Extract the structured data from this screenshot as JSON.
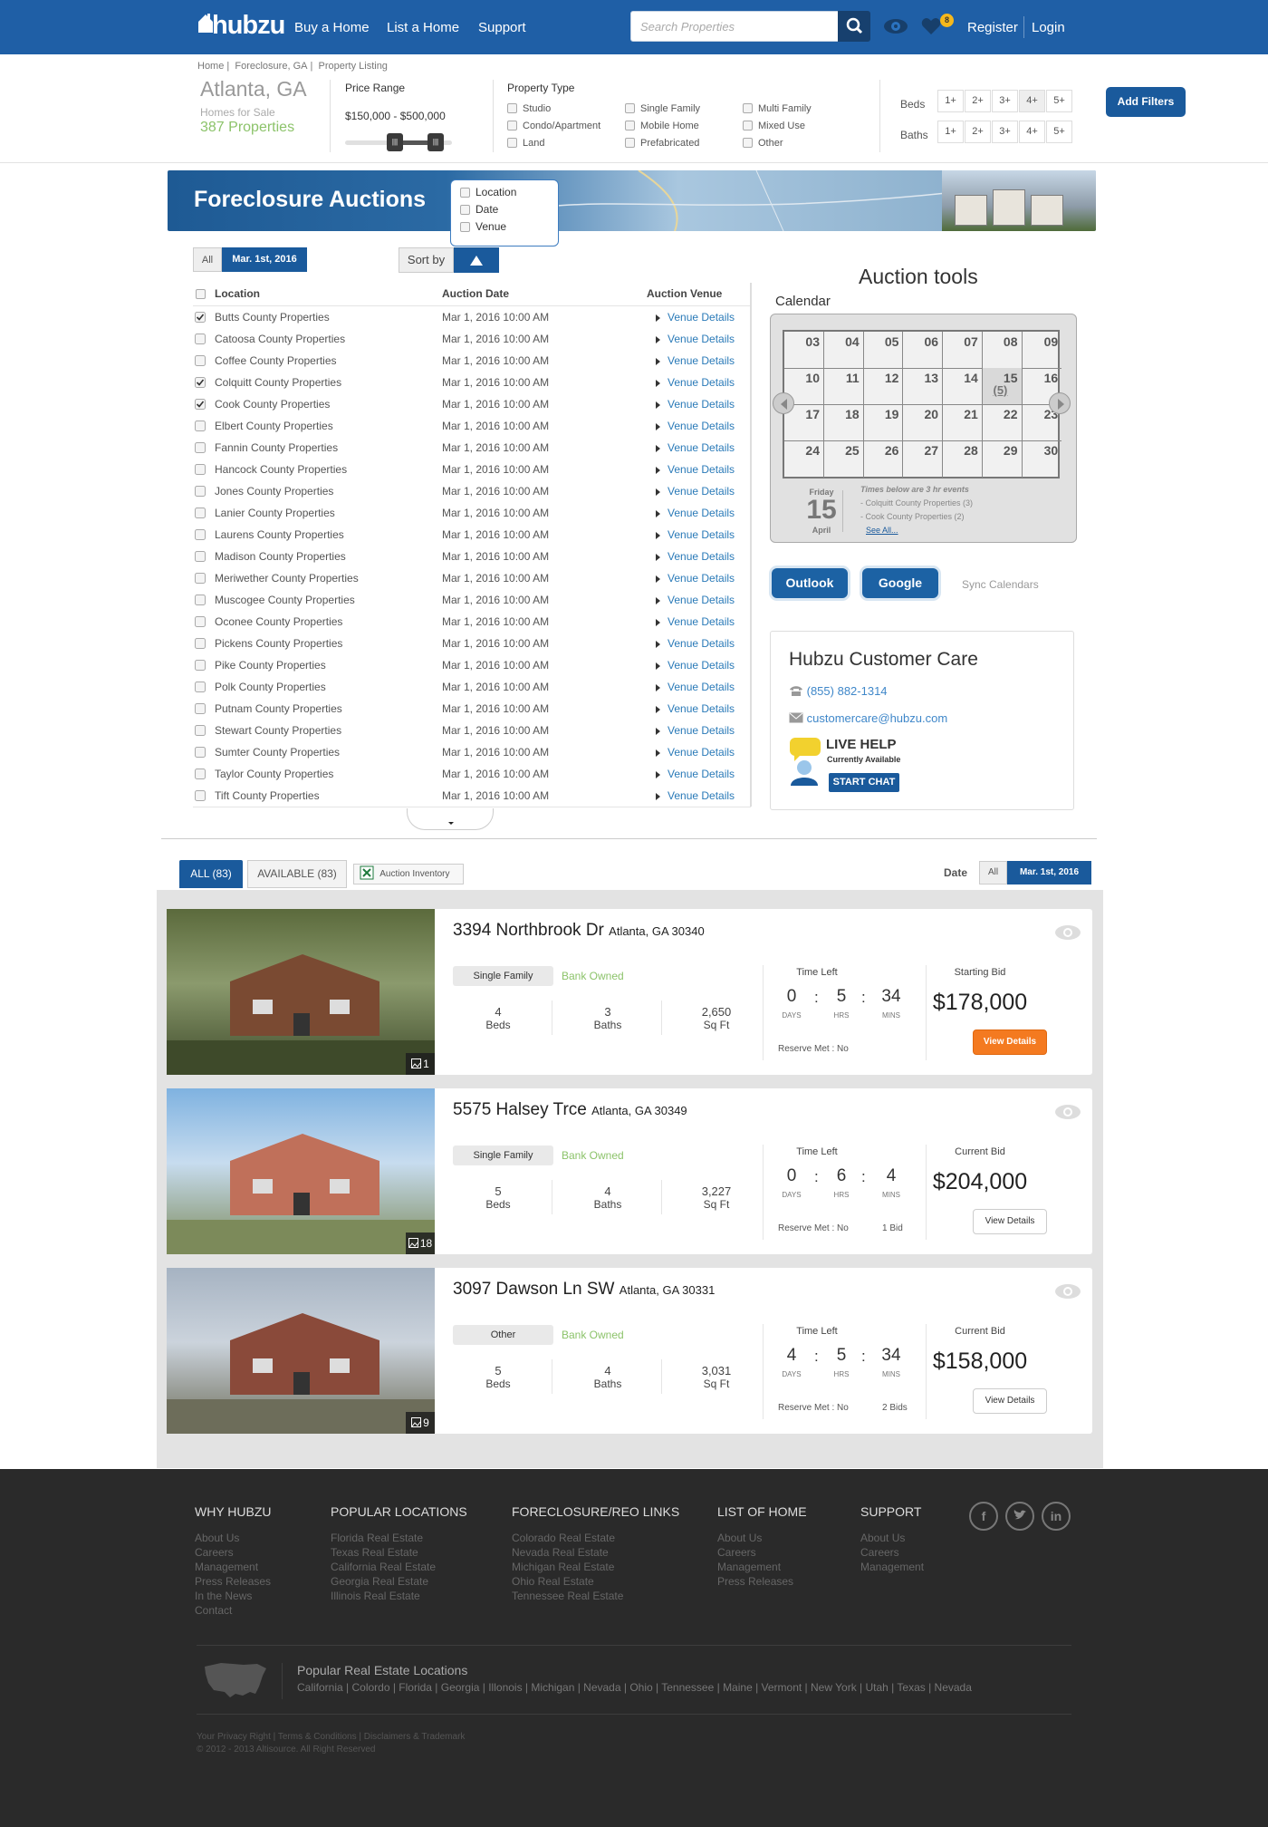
{
  "header": {
    "logo": "hubzu",
    "nav": [
      "Buy a Home",
      "List a Home",
      "Support"
    ],
    "search_placeholder": "Search Properties",
    "favorites_count": "8",
    "register": "Register",
    "login": "Login"
  },
  "filters": {
    "breadcrumb": [
      "Home",
      "Foreclosure, GA",
      "Property Listing"
    ],
    "city": "Atlanta, GA",
    "homes_for_sale": "Homes for Sale",
    "properties": "387 Properties",
    "price_range_label": "Price Range",
    "price_range_value": "$150,000 - $500,000",
    "property_type_label": "Property Type",
    "property_types": [
      "Studio",
      "Condo/Apartment",
      "Land",
      "Single Family",
      "Mobile Home",
      "Prefabricated",
      "Multi Family",
      "Mixed Use",
      "Other"
    ],
    "beds_label": "Beds",
    "baths_label": "Baths",
    "bed_options": [
      "1+",
      "2+",
      "3+",
      "4+",
      "5+"
    ],
    "bath_options": [
      "1+",
      "2+",
      "3+",
      "4+",
      "5+"
    ],
    "add_filters": "Add Filters"
  },
  "auctions": {
    "banner_title": "Foreclosure Auctions",
    "sort_options": [
      "Location",
      "Date",
      "Venue"
    ],
    "seg_all": "All",
    "seg_date": "Mar. 1st, 2016",
    "sort_by": "Sort by",
    "col_location": "Location",
    "col_date": "Auction Date",
    "col_venue": "Auction Venue",
    "rows": [
      {
        "location": "Butts County Properties",
        "date": "Mar 1, 2016 10:00 AM",
        "venue": "Venue Details",
        "checked": true
      },
      {
        "location": "Catoosa County Properties",
        "date": "Mar 1, 2016 10:00 AM",
        "venue": "Venue Details",
        "checked": false
      },
      {
        "location": "Coffee County Properties",
        "date": "Mar 1, 2016 10:00 AM",
        "venue": "Venue Details",
        "checked": false
      },
      {
        "location": "Colquitt County Properties",
        "date": "Mar 1, 2016 10:00 AM",
        "venue": "Venue Details",
        "checked": true
      },
      {
        "location": "Cook County Properties",
        "date": "Mar 1, 2016 10:00 AM",
        "venue": "Venue Details",
        "checked": true
      },
      {
        "location": "Elbert County Properties",
        "date": "Mar 1, 2016 10:00 AM",
        "venue": "Venue Details",
        "checked": false
      },
      {
        "location": "Fannin County Properties",
        "date": "Mar 1, 2016 10:00 AM",
        "venue": "Venue Details",
        "checked": false
      },
      {
        "location": "Hancock County Properties",
        "date": "Mar 1, 2016 10:00 AM",
        "venue": "Venue Details",
        "checked": false
      },
      {
        "location": "Jones County Properties",
        "date": "Mar 1, 2016 10:00 AM",
        "venue": "Venue Details",
        "checked": false
      },
      {
        "location": "Lanier County Properties",
        "date": "Mar 1, 2016 10:00 AM",
        "venue": "Venue Details",
        "checked": false
      },
      {
        "location": "Laurens County Properties",
        "date": "Mar 1, 2016 10:00 AM",
        "venue": "Venue Details",
        "checked": false
      },
      {
        "location": "Madison County Properties",
        "date": "Mar 1, 2016 10:00 AM",
        "venue": "Venue Details",
        "checked": false
      },
      {
        "location": "Meriwether County Properties",
        "date": "Mar 1, 2016 10:00 AM",
        "venue": "Venue Details",
        "checked": false
      },
      {
        "location": "Muscogee County Properties",
        "date": "Mar 1, 2016 10:00 AM",
        "venue": "Venue Details",
        "checked": false
      },
      {
        "location": "Oconee County Properties",
        "date": "Mar 1, 2016 10:00 AM",
        "venue": "Venue Details",
        "checked": false
      },
      {
        "location": "Pickens County Properties",
        "date": "Mar 1, 2016 10:00 AM",
        "venue": "Venue Details",
        "checked": false
      },
      {
        "location": "Pike County Properties",
        "date": "Mar 1, 2016 10:00 AM",
        "venue": "Venue Details",
        "checked": false
      },
      {
        "location": "Polk County Properties",
        "date": "Mar 1, 2016 10:00 AM",
        "venue": "Venue Details",
        "checked": false
      },
      {
        "location": "Putnam County Properties",
        "date": "Mar 1, 2016 10:00 AM",
        "venue": "Venue Details",
        "checked": false
      },
      {
        "location": "Stewart County Properties",
        "date": "Mar 1, 2016 10:00 AM",
        "venue": "Venue Details",
        "checked": false
      },
      {
        "location": "Sumter County Properties",
        "date": "Mar 1, 2016 10:00 AM",
        "venue": "Venue Details",
        "checked": false
      },
      {
        "location": "Taylor County Properties",
        "date": "Mar 1, 2016 10:00 AM",
        "venue": "Venue Details",
        "checked": false
      },
      {
        "location": "Tift County Properties",
        "date": "Mar 1, 2016 10:00 AM",
        "venue": "Venue Details",
        "checked": false
      }
    ]
  },
  "tools": {
    "title": "Auction tools",
    "calendar_label": "Calendar",
    "weeks": [
      [
        "03",
        "04",
        "05",
        "06",
        "07",
        "08",
        "09"
      ],
      [
        "10",
        "11",
        "12",
        "13",
        "14",
        "15",
        "16"
      ],
      [
        "17",
        "18",
        "19",
        "20",
        "21",
        "22",
        "23"
      ],
      [
        "24",
        "25",
        "26",
        "27",
        "28",
        "29",
        "30"
      ]
    ],
    "highlight_count": "(5)",
    "day_name": "Friday",
    "day_num": "15",
    "month": "April",
    "events_note": "Times below are 3 hr events",
    "events": [
      "- Colquitt County Properties (3)",
      "- Cook County Properties (2)"
    ],
    "see_all": "See All...",
    "outlook": "Outlook",
    "google": "Google",
    "sync": "Sync Calendars"
  },
  "care": {
    "title": "Hubzu Customer Care",
    "phone": "(855) 882-1314",
    "email": "customercare@hubzu.com",
    "live_help": "LIVE HELP",
    "availability": "Currently Available",
    "start_chat": "START CHAT"
  },
  "listing": {
    "tab_all": "ALL (83)",
    "tab_available": "AVAILABLE (83)",
    "inventory": "Auction Inventory",
    "date_label": "Date",
    "date_all": "All",
    "date_value": "Mar. 1st, 2016",
    "cards": [
      {
        "address": "3394 Northbrook Dr",
        "citystate": "Atlanta, GA 30340",
        "type": "Single Family",
        "status": "Bank Owned",
        "beds": "4",
        "baths": "3",
        "sqft": "2,650",
        "days": "0",
        "hrs": "5",
        "mins": "34",
        "reserve": "Reserve Met : No",
        "bids": "",
        "bid_label": "Starting Bid",
        "bid": "$178,000",
        "photos": "1",
        "primary": true
      },
      {
        "address": "5575 Halsey Trce",
        "citystate": "Atlanta, GA 30349",
        "type": "Single Family",
        "status": "Bank Owned",
        "beds": "5",
        "baths": "4",
        "sqft": "3,227",
        "days": "0",
        "hrs": "6",
        "mins": "4",
        "reserve": "Reserve Met : No",
        "bids": "1 Bid",
        "bid_label": "Current Bid",
        "bid": "$204,000",
        "photos": "18",
        "primary": false
      },
      {
        "address": "3097 Dawson Ln SW",
        "citystate": "Atlanta, GA 30331",
        "type": "Other",
        "status": "Bank Owned",
        "beds": "5",
        "baths": "4",
        "sqft": "3,031",
        "days": "4",
        "hrs": "5",
        "mins": "34",
        "reserve": "Reserve Met : No",
        "bids": "2 Bids",
        "bid_label": "Current Bid",
        "bid": "$158,000",
        "photos": "9",
        "primary": false
      }
    ],
    "labels": {
      "beds": "Beds",
      "baths": "Baths",
      "sqft": "Sq Ft",
      "time_left": "Time Left",
      "days": "DAYS",
      "hrs": "HRS",
      "mins": "MINS",
      "view": "View Details"
    }
  },
  "footer": {
    "cols": [
      {
        "title": "WHY HUBZU",
        "links": [
          "About Us",
          "Careers",
          "Management",
          "Press Releases",
          "In the News",
          "Contact"
        ]
      },
      {
        "title": "POPULAR LOCATIONS",
        "links": [
          "Florida Real Estate",
          "Texas Real Estate",
          "California Real Estate",
          "Georgia Real Estate",
          "Illinois Real Estate"
        ]
      },
      {
        "title": "FORECLOSURE/REO LINKS",
        "links": [
          "Colorado Real Estate",
          "Nevada Real Estate",
          "Michigan Real Estate",
          "Ohio Real Estate",
          "Tennessee Real Estate"
        ]
      },
      {
        "title": "LIST OF HOME",
        "links": [
          "About Us",
          "Careers",
          "Management",
          "Press Releases"
        ]
      },
      {
        "title": "SUPPORT",
        "links": [
          "About Us",
          "Careers",
          "Management"
        ]
      }
    ],
    "popular_title": "Popular Real Estate Locations",
    "popular": "California  |  Colordo  |  Florida  |  Georgia  |  Illonois  |  Michigan  |  Nevada  |  Ohio  |  Tennessee  |  Maine  |  Vermont  |  New York  |  Utah  |  Texas  |  Nevada",
    "legal": "Your Privacy Right  |  Terms & Conditions  |  Disclaimers & Trademark",
    "copyright": "© 2012 - 2013 Altisource. All Right Reserved"
  },
  "colors": {
    "brand": "#1f5fa6",
    "accent_orange": "#f47a20",
    "green": "#8cc36a",
    "link": "#2a7ab8"
  }
}
